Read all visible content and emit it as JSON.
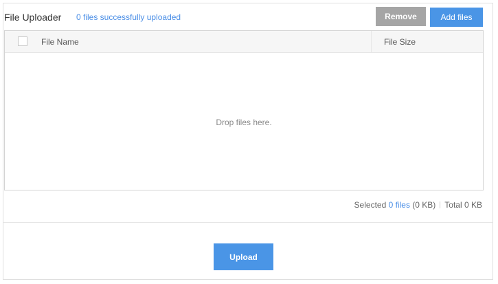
{
  "header": {
    "title": "File Uploader",
    "status": "0 files successfully uploaded",
    "remove_label": "Remove",
    "add_label": "Add files"
  },
  "table": {
    "columns": [
      "File Name",
      "File Size"
    ],
    "empty_message": "Drop files here."
  },
  "summary": {
    "selected_prefix": "Selected ",
    "selected_files": "0 files",
    "selected_size": " (0 KB)",
    "total": "Total 0 KB"
  },
  "footer": {
    "upload_label": "Upload"
  },
  "colors": {
    "accent": "#4a95e6",
    "link": "#4a8ee6",
    "remove_button": "#a5a5a5"
  }
}
